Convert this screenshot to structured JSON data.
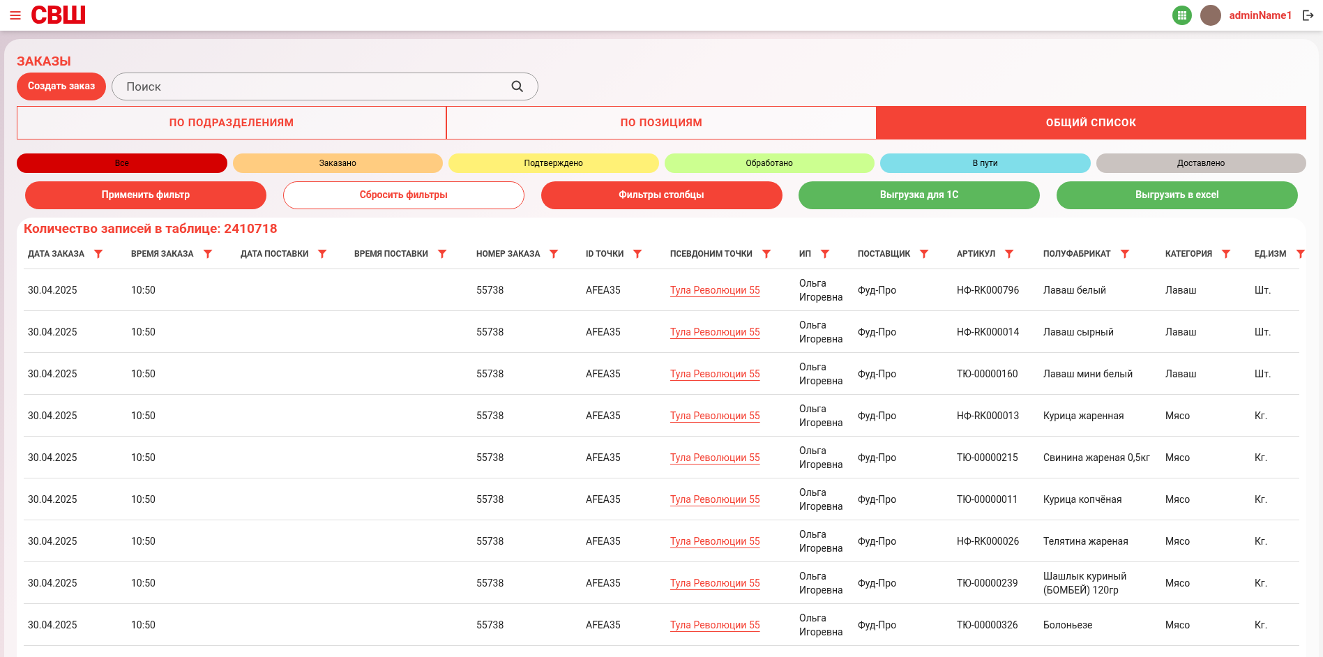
{
  "header": {
    "logo": "СВШ",
    "user": "adminName1"
  },
  "page": {
    "title": "ЗАКАЗЫ",
    "create_button": "Создать заказ",
    "search": {
      "placeholder": "Поиск"
    }
  },
  "tabs": [
    {
      "label": "ПО ПОДРАЗДЕЛЕНИЯМ",
      "selected": false
    },
    {
      "label": "ПО ПОЗИЦИЯМ",
      "selected": false
    },
    {
      "label": "ОБЩИЙ СПИСОК",
      "selected": true
    }
  ],
  "status_filters": [
    {
      "label": "Все",
      "color": "#d50000"
    },
    {
      "label": "Заказано",
      "color": "#ffcc80"
    },
    {
      "label": "Подтверждено",
      "color": "#fff176"
    },
    {
      "label": "Обработано",
      "color": "#ccff90"
    },
    {
      "label": "В пути",
      "color": "#80deea"
    },
    {
      "label": "Доставлено",
      "color": "#cac3c0"
    }
  ],
  "actions": [
    {
      "label": "Применить фильтр",
      "kind": "primary"
    },
    {
      "label": "Сбросить фильтры",
      "kind": "outline"
    },
    {
      "label": "Фильтры столбцы",
      "kind": "primary"
    },
    {
      "label": "Выгрузка для 1С",
      "kind": "success"
    },
    {
      "label": "Выгрузить в excel",
      "kind": "success"
    }
  ],
  "record_count": "Количество записей в таблице: 2410718",
  "table": {
    "columns": [
      "ДАТА ЗАКАЗА",
      "ВРЕМЯ ЗАКАЗА",
      "ДАТА ПОСТАВКИ",
      "ВРЕМЯ ПОСТАВКИ",
      "НОМЕР ЗАКАЗА",
      "ID ТОЧКИ",
      "ПСЕВДОНИМ ТОЧКИ",
      "ИП",
      "ПОСТАВЩИК",
      "АРТИКУЛ",
      "ПОЛУФАБРИКАТ",
      "КАТЕГОРИЯ",
      "ЕД.ИЗМ"
    ],
    "rows": [
      [
        "30.04.2025",
        "10:50",
        "",
        "",
        "55738",
        "AFEA35",
        "Тула Революции 55",
        "Ольга Игоревна",
        "Фуд-Про",
        "НФ-RK000796",
        "Лаваш белый",
        "Лаваш",
        "Шт."
      ],
      [
        "30.04.2025",
        "10:50",
        "",
        "",
        "55738",
        "AFEA35",
        "Тула Революции 55",
        "Ольга Игоревна",
        "Фуд-Про",
        "НФ-RK000014",
        "Лаваш сырный",
        "Лаваш",
        "Шт."
      ],
      [
        "30.04.2025",
        "10:50",
        "",
        "",
        "55738",
        "AFEA35",
        "Тула Революции 55",
        "Ольга Игоревна",
        "Фуд-Про",
        "ТЮ-00000160",
        "Лаваш мини белый",
        "Лаваш",
        "Шт."
      ],
      [
        "30.04.2025",
        "10:50",
        "",
        "",
        "55738",
        "AFEA35",
        "Тула Революции 55",
        "Ольга Игоревна",
        "Фуд-Про",
        "НФ-RK000013",
        "Курица жаренная",
        "Мясо",
        "Кг."
      ],
      [
        "30.04.2025",
        "10:50",
        "",
        "",
        "55738",
        "AFEA35",
        "Тула Революции 55",
        "Ольга Игоревна",
        "Фуд-Про",
        "ТЮ-00000215",
        "Свинина жареная 0,5кг",
        "Мясо",
        "Кг."
      ],
      [
        "30.04.2025",
        "10:50",
        "",
        "",
        "55738",
        "AFEA35",
        "Тула Революции 55",
        "Ольга Игоревна",
        "Фуд-Про",
        "ТЮ-00000011",
        "Курица копчёная",
        "Мясо",
        "Кг."
      ],
      [
        "30.04.2025",
        "10:50",
        "",
        "",
        "55738",
        "AFEA35",
        "Тула Революции 55",
        "Ольга Игоревна",
        "Фуд-Про",
        "НФ-RK000026",
        "Телятина жареная",
        "Мясо",
        "Кг."
      ],
      [
        "30.04.2025",
        "10:50",
        "",
        "",
        "55738",
        "AFEA35",
        "Тула Революции 55",
        "Ольга Игоревна",
        "Фуд-Про",
        "ТЮ-00000239",
        "Шашлык куриный (БОМБЕЙ) 120гр",
        "Мясо",
        "Кг."
      ],
      [
        "30.04.2025",
        "10:50",
        "",
        "",
        "55738",
        "AFEA35",
        "Тула Революции 55",
        "Ольга Игоревна",
        "Фуд-Про",
        "ТЮ-00000326",
        "Болоньезе",
        "Мясо",
        "Кг."
      ]
    ]
  }
}
